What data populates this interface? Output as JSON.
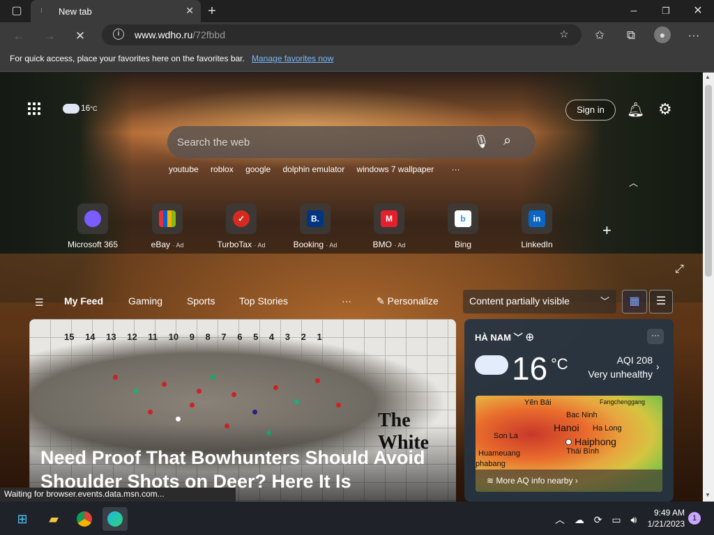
{
  "browser": {
    "tab_title": "New tab",
    "url_host": "www.wdho.ru",
    "url_path": "/72fbbd",
    "fav_message": "For quick access, place your favorites here on the favorites bar.",
    "fav_link": "Manage favorites now"
  },
  "header": {
    "weather_temp": "16",
    "weather_unit": "°C",
    "sign_in": "Sign in"
  },
  "search": {
    "placeholder": "Search the web",
    "suggestions": [
      "youtube",
      "roblox",
      "google",
      "dolphin emulator",
      "windows 7 wallpaper"
    ],
    "more": "···"
  },
  "quick_links": [
    {
      "label": "Microsoft 365",
      "ad": "",
      "color": "#7a5cff"
    },
    {
      "label": "eBay",
      "ad": "· Ad",
      "color": "#e53238"
    },
    {
      "label": "TurboTax",
      "ad": "· Ad",
      "color": "#d52b1e"
    },
    {
      "label": "Booking",
      "ad": "· Ad",
      "color": "#003580"
    },
    {
      "label": "BMO",
      "ad": "· Ad",
      "color": "#0079c1"
    },
    {
      "label": "Bing",
      "ad": "",
      "color": "#258ffa"
    },
    {
      "label": "LinkedIn",
      "ad": "",
      "color": "#0a66c2"
    }
  ],
  "feed": {
    "tabs": [
      "My Feed",
      "Gaming",
      "Sports",
      "Top Stories"
    ],
    "more": "···",
    "personalize": "Personalize",
    "content_visibility": "Content partially visible"
  },
  "article": {
    "title": "Need Proof That Bowhunters Should Avoid Shoulder Shots on Deer? Here It Is",
    "grid_numbers": "15 14 13 12 11 10 9 8 7 6 5 4 3 2 1",
    "caption": "The White"
  },
  "weather_card": {
    "location": "HÀ NAM",
    "temp": "16",
    "unit": "°C",
    "aqi": "AQI 208",
    "aqi_status": "Very unhealthy",
    "map_labels": [
      "Yên Bái",
      "Bac Ninh",
      "Fangchenggang",
      "Son La",
      "Hanoi",
      "Ha Long",
      "Haiphong",
      "Huameuang",
      "Thái Bình",
      "phabang"
    ],
    "footer_link": "More AQ info nearby"
  },
  "status_bar": "Waiting for browser.events.data.msn.com...",
  "taskbar": {
    "time": "9:49 AM",
    "date": "1/21/2023",
    "notifications": "1"
  }
}
